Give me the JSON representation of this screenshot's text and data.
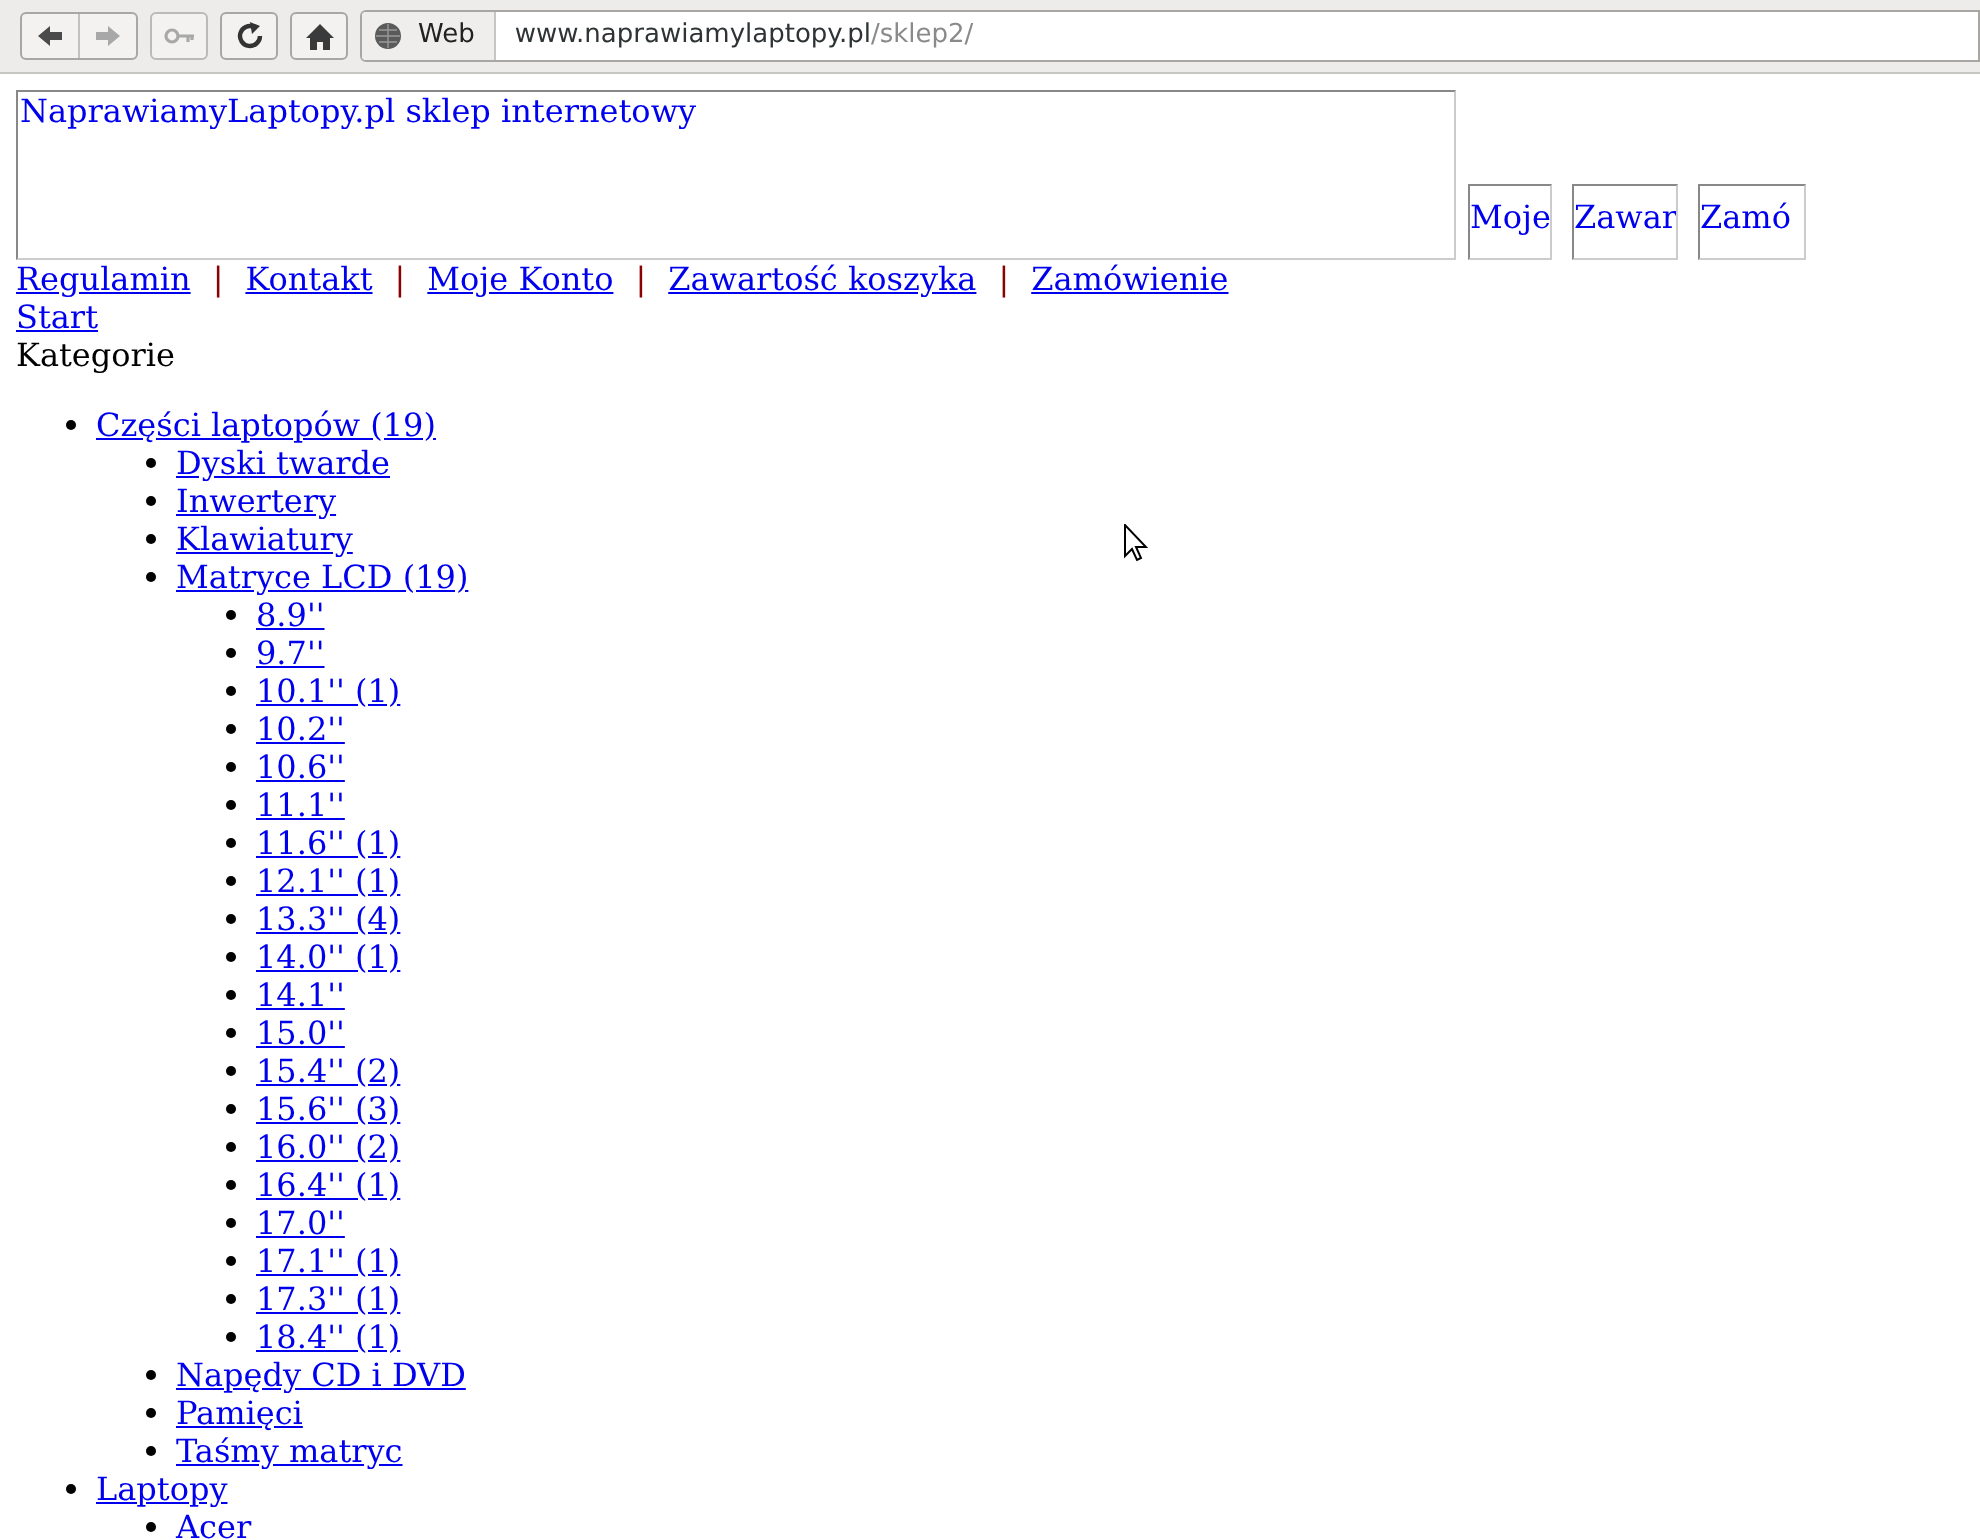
{
  "browser": {
    "location_label": "Web",
    "url_host": "www.naprawiamylaptopy.pl",
    "url_path": "/sklep2/"
  },
  "header": {
    "title": "NaprawiamyLaptopy.pl sklep internetowy",
    "boxes": [
      "Moje",
      "Zawar",
      "Zamó"
    ]
  },
  "nav": [
    {
      "kind": "link",
      "text": "Regulamin"
    },
    {
      "kind": "separator",
      "text": "|"
    },
    {
      "kind": "link",
      "text": "Kontakt"
    },
    {
      "kind": "separator",
      "text": "|"
    },
    {
      "kind": "link",
      "text": "Moje Konto"
    },
    {
      "kind": "separator",
      "text": "|"
    },
    {
      "kind": "link",
      "text": "Zawartość koszyka"
    },
    {
      "kind": "separator",
      "text": "|"
    },
    {
      "kind": "link",
      "text": "Zamówienie"
    }
  ],
  "start_link": "Start",
  "categories_heading": "Kategorie",
  "categories": [
    {
      "label": "Części laptopów (19)",
      "children": [
        {
          "label": "Dyski twarde"
        },
        {
          "label": "Inwertery"
        },
        {
          "label": "Klawiatury"
        },
        {
          "label": "Matryce LCD (19)",
          "children": [
            {
              "label": "8.9''"
            },
            {
              "label": "9.7''"
            },
            {
              "label": "10.1'' (1)"
            },
            {
              "label": "10.2''"
            },
            {
              "label": "10.6''"
            },
            {
              "label": "11.1''"
            },
            {
              "label": "11.6'' (1)"
            },
            {
              "label": "12.1'' (1)"
            },
            {
              "label": "13.3'' (4)"
            },
            {
              "label": "14.0'' (1)"
            },
            {
              "label": "14.1''"
            },
            {
              "label": "15.0''"
            },
            {
              "label": "15.4'' (2)"
            },
            {
              "label": "15.6'' (3)"
            },
            {
              "label": "16.0'' (2)"
            },
            {
              "label": "16.4'' (1)"
            },
            {
              "label": "17.0''"
            },
            {
              "label": "17.1'' (1)"
            },
            {
              "label": "17.3'' (1)"
            },
            {
              "label": "18.4'' (1)"
            }
          ]
        },
        {
          "label": "Napędy CD i DVD"
        },
        {
          "label": "Pamięci"
        },
        {
          "label": "Taśmy matryc"
        }
      ]
    },
    {
      "label": "Laptopy",
      "children": [
        {
          "label": "Acer"
        }
      ]
    }
  ]
}
